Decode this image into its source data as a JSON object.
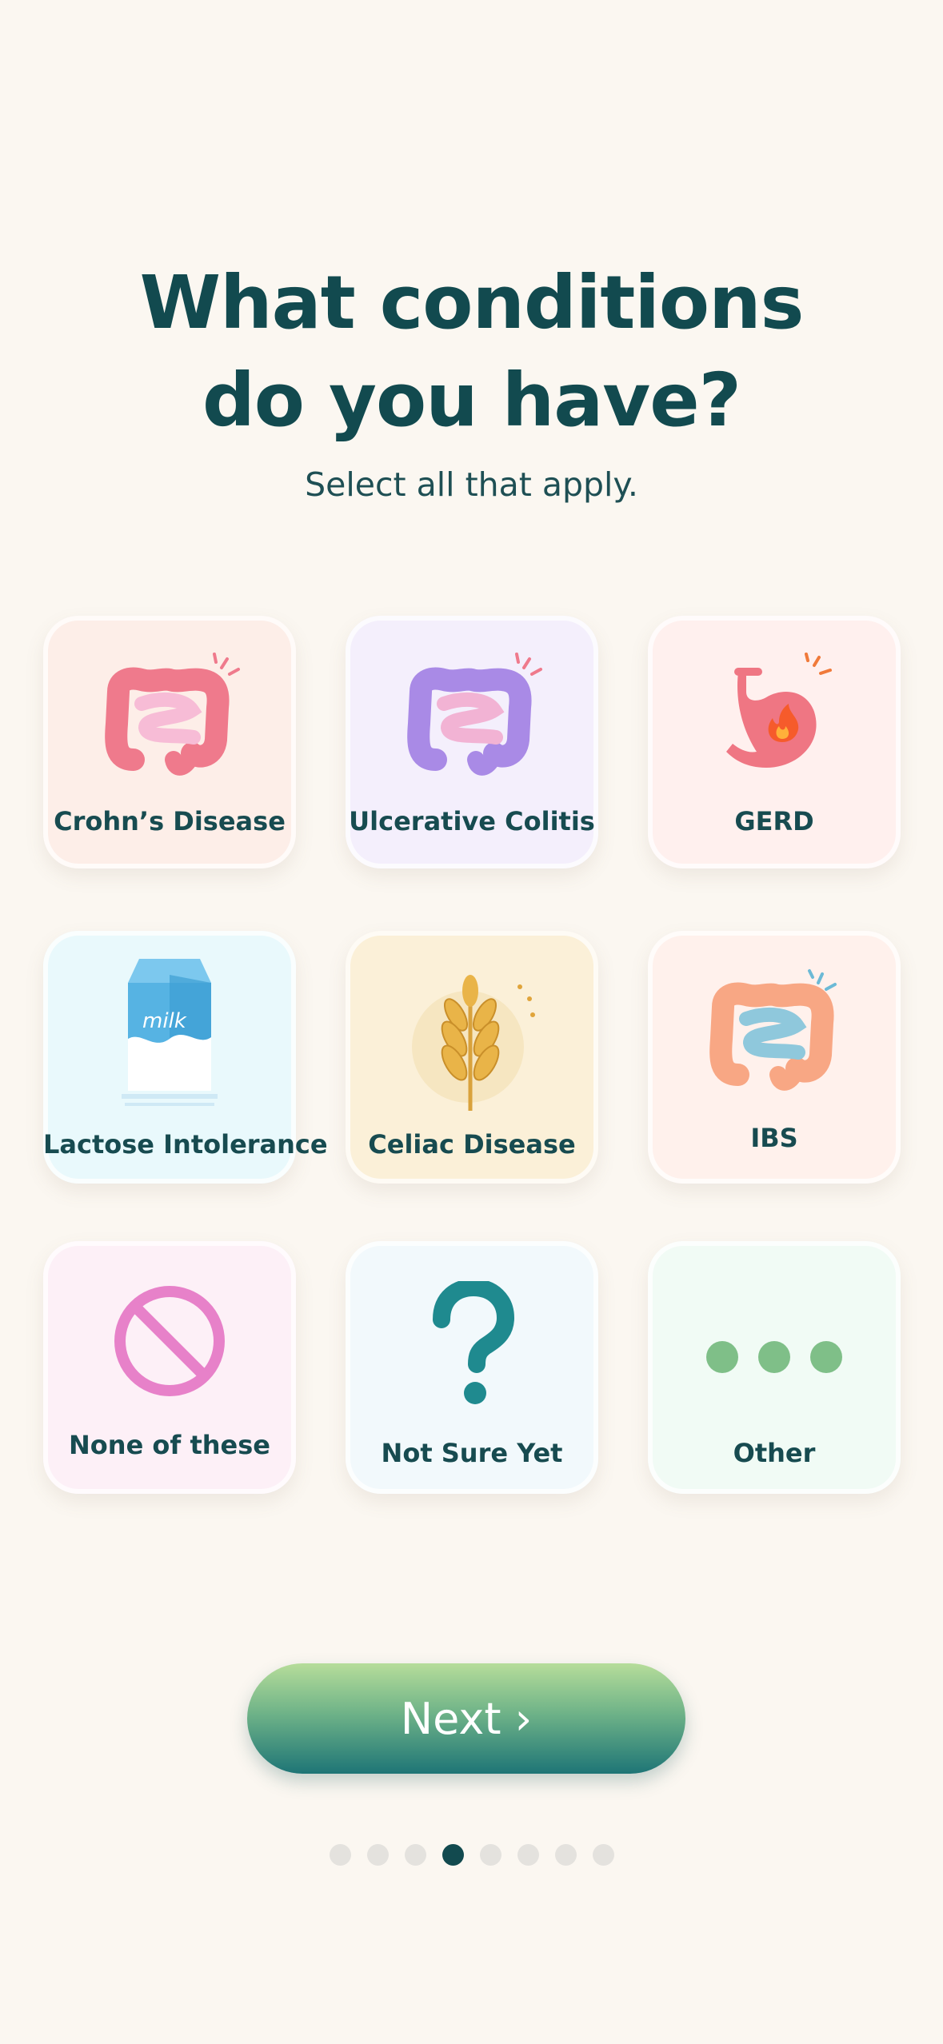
{
  "heading": {
    "line1": "What conditions",
    "line2": "do you have?"
  },
  "subheading": "Select all that apply.",
  "options": [
    {
      "label": "Crohn’s Disease",
      "icon": "intestine-icon",
      "color": "#fdeee8"
    },
    {
      "label": "Ulcerative Colitis",
      "icon": "colon-icon",
      "color": "#f4effc"
    },
    {
      "label": "GERD",
      "icon": "stomach-fire-icon",
      "color": "#fff0ee"
    },
    {
      "label": "Lactose Intolerance",
      "icon": "milk-carton-icon",
      "color": "#e9f9fc"
    },
    {
      "label": "Celiac Disease",
      "icon": "wheat-icon",
      "color": "#fbf0d8"
    },
    {
      "label": "IBS",
      "icon": "intestine-icon",
      "color": "#fff1ec"
    },
    {
      "label": "None of these",
      "icon": "prohibited-icon",
      "color": "#fdf0f7"
    },
    {
      "label": "Not Sure Yet",
      "icon": "question-mark-icon",
      "color": "#f2f9fc"
    },
    {
      "label": "Other",
      "icon": "ellipsis-icon",
      "color": "#f1fbf5"
    }
  ],
  "milk_text": "milk",
  "next_button": {
    "label": "Next ›"
  },
  "pagination": {
    "total": 8,
    "current": 4
  },
  "colors": {
    "primary": "#124a4f",
    "background": "#fbf7f1"
  }
}
